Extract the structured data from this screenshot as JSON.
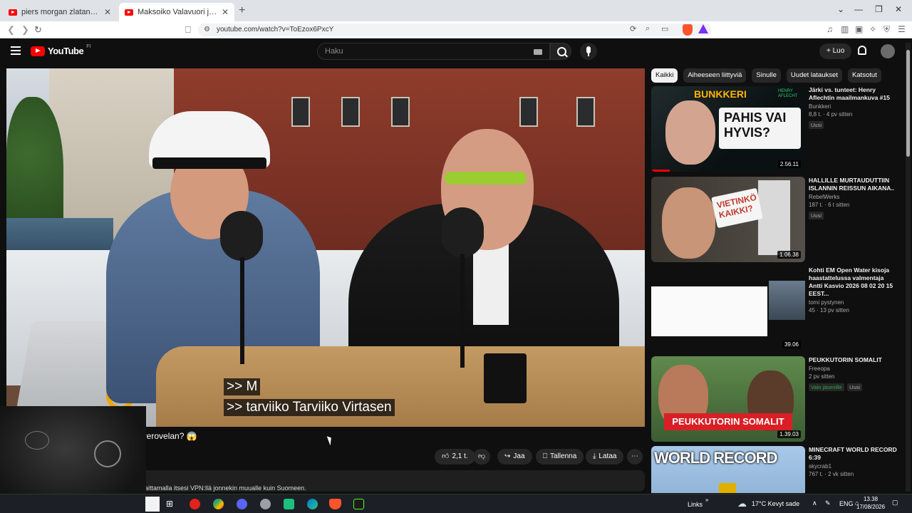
{
  "browser": {
    "tabs": [
      {
        "label": "piers morgan zlatan ibrahimovic - YouTube",
        "active": false
      },
      {
        "label": "Maksoiko Valavuori just miljo",
        "active": true
      }
    ],
    "new_tab_icon": "plus-icon",
    "url": "youtube.com/watch?v=ToEzox6PxcY",
    "window_controls": [
      "⌄",
      "—",
      "❐",
      "✕"
    ]
  },
  "youtube": {
    "logo": "YouTube",
    "logo_country": "FI",
    "search_placeholder": "Haku",
    "create_label": "+ Luo",
    "brand_color": "#ff0000"
  },
  "video": {
    "subtitle_lines": [
      ">> M",
      ">> tarviiko Tarviiko Virtasen"
    ],
    "title_prefix": "M",
    "title_visible": "an verovelan? 😱",
    "actions": {
      "like_count": "2,1 t.",
      "share": "Jaa",
      "save": "Tallenna",
      "download": "Lataa"
    },
    "description": "laittamalla itsesi VPN:llä jonnekin muualle kuin Suomeen."
  },
  "sidebar": {
    "chips": [
      "Kaikki",
      "Aiheeseen liittyviä",
      "Sinulle",
      "Uudet lataukset",
      "Katsotut"
    ],
    "active_chip": "Kaikki",
    "items": [
      {
        "title": "Järki vs. tunteet: Henry Aflechtin maailmankuva #15",
        "channel": "Bunkkeri",
        "meta": "8,8 t. · 4 pv sitten",
        "badge": "Uusi",
        "duration": "2.56.11",
        "thumb_top": "BUNKKERI",
        "thumb_tag": "HENRY AFLECHT",
        "thumb_main": "PAHIS VAI HYVIS?",
        "watched_fraction": 0.12
      },
      {
        "title": "HALLILLE MURTAUDUTTIIN ISLANNIN REISSUN AIKANA..",
        "channel": "RebelWerks",
        "meta": "187 t. · 6 t sitten",
        "badge": "Uusi",
        "duration": "1.06.38",
        "thumb_main": "VIETINKÖ KAIKKI?"
      },
      {
        "title": "Kohti EM Open Water kisoja haastattelussa valmentaja Antti Kasvio 2026 08 02 20 15 EEST...",
        "channel": "tomi pystynen",
        "meta": "45 · 13 pv sitten",
        "badge": "",
        "duration": "39.06"
      },
      {
        "title": "PEUKKUTORIN SOMALIT",
        "channel": "Freeopa",
        "meta": "2 pv sitten",
        "badge": "Vain jäsenille",
        "badge2": "Uusi",
        "duration": "1.39.03",
        "thumb_main": "PEUKKUTORIN SOMALIT"
      },
      {
        "title": "MINECRAFT WORLD RECORD 6:39",
        "channel": "skycrab1",
        "meta": "767 t. · 2 vk sitten",
        "badge": "",
        "thumb_main": "WORLD RECORD"
      }
    ]
  },
  "taskbar": {
    "links": "Links",
    "weather": "17°C  Kevyt sade",
    "language": "ENG",
    "time": "13.38",
    "date": "17/08/2026"
  }
}
